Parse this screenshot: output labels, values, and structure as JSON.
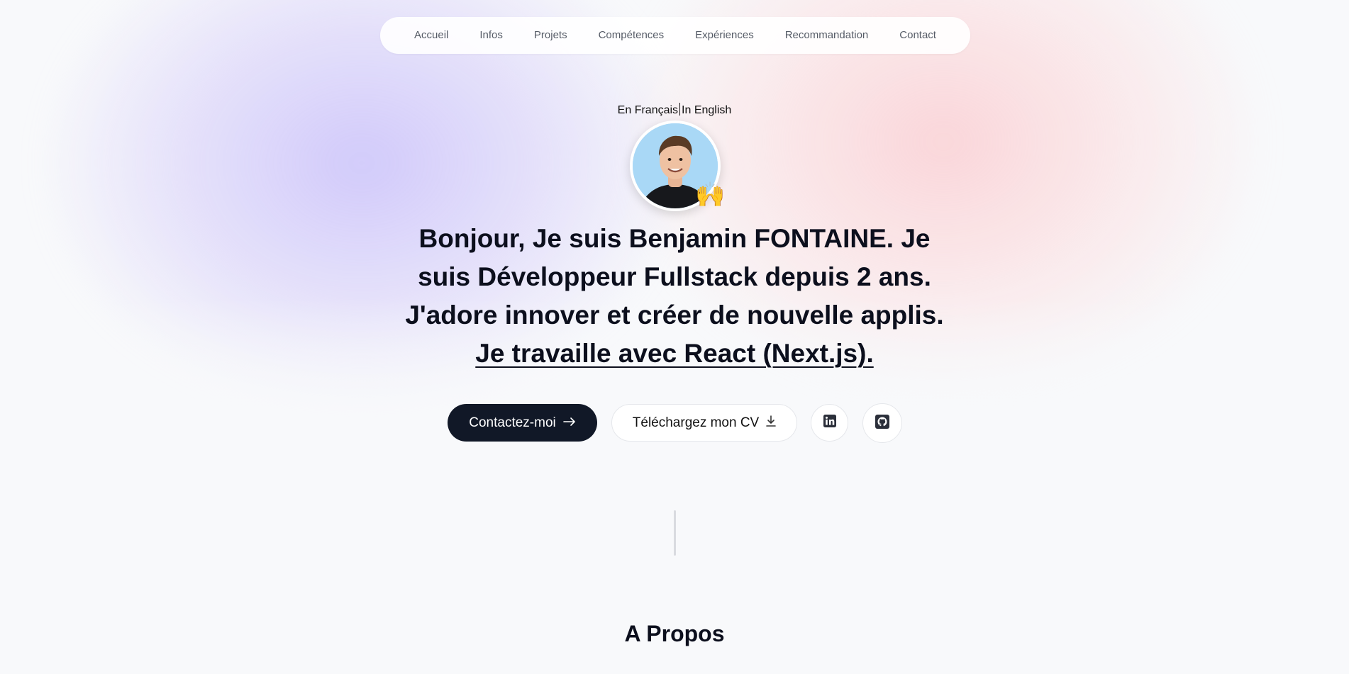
{
  "nav": {
    "items": [
      "Accueil",
      "Infos",
      "Projets",
      "Compétences",
      "Expériences",
      "Recommandation",
      "Contact"
    ]
  },
  "language": {
    "fr": "En Français",
    "en": "In English"
  },
  "avatar": {
    "emoji": "🙌"
  },
  "headline": {
    "greeting": "Bonjour,",
    "intro": " Je suis Benjamin FONTAINE. ",
    "role": "Je suis Développeur Fullstack depuis 2 ans.",
    "passion": " J'adore innover et créer de nouvelle applis. ",
    "stack": "Je travaille avec React (Next.js)."
  },
  "actions": {
    "contact_label": "Contactez-moi",
    "contact_icon": "arrow-right-icon",
    "cv_label": "Téléchargez mon CV",
    "cv_icon": "download-icon",
    "linkedin_icon": "linkedin-icon",
    "github_icon": "github-icon"
  },
  "about": {
    "title": "A Propos"
  },
  "colors": {
    "primary_button": "#111827",
    "text": "#0c0f1d",
    "accent_purple": "#c4bafa",
    "accent_pink": "#fbcace"
  }
}
